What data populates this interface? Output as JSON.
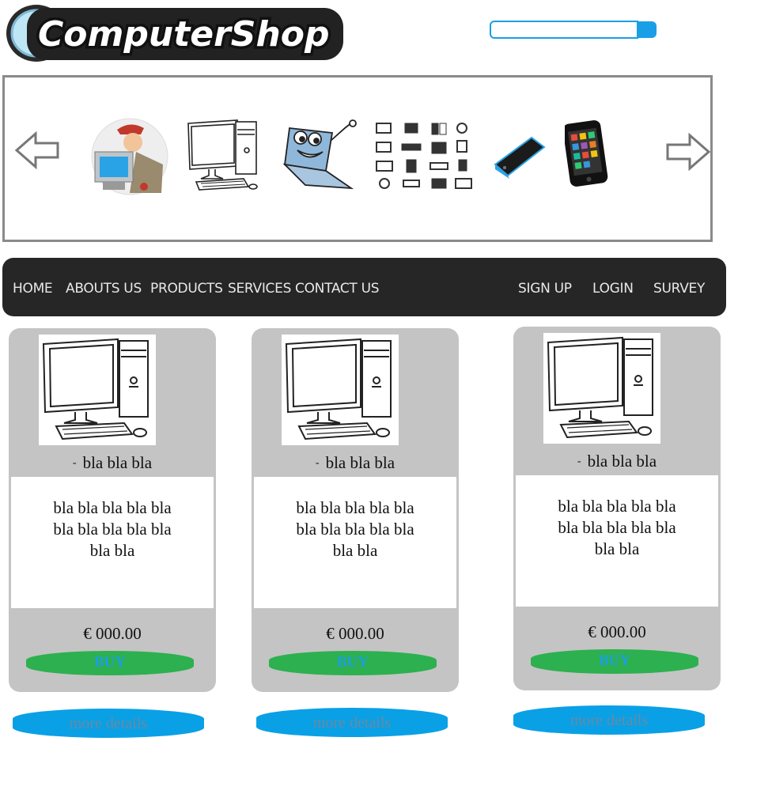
{
  "brand": {
    "logo_text": "ComputerShop"
  },
  "search": {
    "placeholder": ""
  },
  "carousel": {
    "items": [
      {
        "icon": "technician-icon"
      },
      {
        "icon": "desktop-computer-icon"
      },
      {
        "icon": "cartoon-laptop-icon"
      },
      {
        "icon": "component-grid-icon"
      },
      {
        "icon": "mobile-phone-icon"
      },
      {
        "icon": "smartphone-icon"
      }
    ]
  },
  "nav": {
    "left": [
      "HOME",
      "ABOUTS US",
      "PRODUCTS",
      "SERVICES",
      "CONTACT US"
    ],
    "right": [
      "SIGN UP",
      "LOGIN",
      "SURVEY"
    ]
  },
  "products": [
    {
      "title": "bla bla bla",
      "desc": "bla bla bla bla bla bla bla bla bla bla bla bla",
      "price": "€ 000.00",
      "buy_label": "BUY",
      "details_label": "more details"
    },
    {
      "title": "bla bla bla",
      "desc": "bla bla bla bla bla bla bla bla bla bla bla bla",
      "price": "€ 000.00",
      "buy_label": "BUY",
      "details_label": "more details"
    },
    {
      "title": "bla bla bla",
      "desc": "bla bla bla bla bla bla bla bla bla bla bla bla",
      "price": "€ 000.00",
      "buy_label": "BUY",
      "details_label": "more details"
    }
  ],
  "colors": {
    "nav_bg": "#262626",
    "card_bg": "#c4c4c4",
    "buy_bg": "#2db04f",
    "details_bg": "#0aa0e6",
    "accent": "#1a9fe6"
  }
}
